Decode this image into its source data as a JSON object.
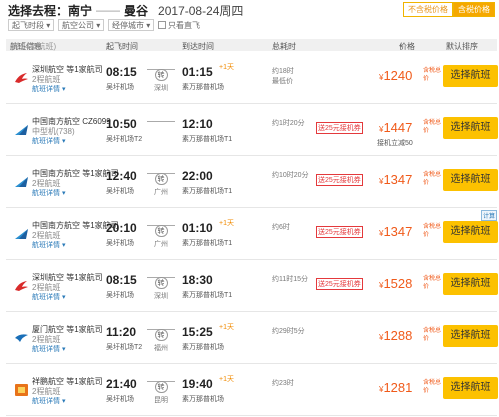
{
  "header": {
    "prefix": "选择去程：",
    "origin": "南宁",
    "dash": "——",
    "destination": "曼谷",
    "date": "2017-08-24周四"
  },
  "price_toggle": {
    "off_label": "不含税价格",
    "on_label": "含税价格"
  },
  "filters": {
    "takeoff_time": "起飞时段",
    "airline": "航空公司",
    "stopover_city": "经停城市",
    "direct_only": "只看直飞"
  },
  "columns": {
    "flight": "航班信息",
    "flight_hint": "(共24条航班)",
    "dep_time": "起飞时间",
    "arr_time": "到达时间",
    "total_time": "总耗时",
    "price": "价格",
    "sort": "默认排序"
  },
  "colors": {
    "accent": "#fcc100",
    "price": "#f05a1a",
    "link": "#2a7ab8"
  },
  "flights": [
    {
      "airline": "深圳航空 等1家航司",
      "sub": "2程航班",
      "details": "航班详情",
      "logo": "crane-logo-red",
      "dep_time": "08:15",
      "dep_airport": "吴圩机场",
      "stop_city": "深圳",
      "stop_badge": "转",
      "arr_time": "01:15",
      "plus_day": "+1天",
      "arr_airport": "素万那普机场",
      "duration": "约18时",
      "duration_note": "最低价",
      "promo": "",
      "price": "1240",
      "tax_label": "含税总价",
      "remark": "",
      "tag": "",
      "button": "选择航班"
    },
    {
      "airline": "中国南方航空 CZ6099",
      "sub": "中型机(738)",
      "details": "航班详情",
      "logo": "kapok-logo-blue",
      "dep_time": "10:50",
      "dep_airport": "吴圩机场T2",
      "stop_city": "",
      "stop_badge": "",
      "arr_time": "12:10",
      "plus_day": "",
      "arr_airport": "素万那普机场T1",
      "duration": "约1时20分",
      "duration_note": "",
      "promo": "送25元接机券",
      "price": "1447",
      "tax_label": "含税总价",
      "remark": "接机立减50",
      "tag": "",
      "button": "选择航班"
    },
    {
      "airline": "中国南方航空 等1家航司",
      "sub": "2程航班",
      "details": "航班详情",
      "logo": "kapok-logo-blue",
      "dep_time": "12:40",
      "dep_airport": "吴圩机场",
      "stop_city": "广州",
      "stop_badge": "转",
      "arr_time": "22:00",
      "plus_day": "",
      "arr_airport": "素万那普机场T1",
      "duration": "约10时20分",
      "duration_note": "",
      "promo": "送25元接机券",
      "price": "1347",
      "tax_label": "含税总价",
      "remark": "",
      "tag": "",
      "button": "选择航班"
    },
    {
      "airline": "中国南方航空 等1家航司",
      "sub": "2程航班",
      "details": "航班详情",
      "logo": "kapok-logo-blue",
      "dep_time": "20:10",
      "dep_airport": "吴圩机场",
      "stop_city": "广州",
      "stop_badge": "转",
      "arr_time": "01:10",
      "plus_day": "+1天",
      "arr_airport": "素万那普机场T1",
      "duration": "约6时",
      "duration_note": "",
      "promo": "送25元接机券",
      "price": "1347",
      "tax_label": "含税总价",
      "remark": "",
      "tag": "计算",
      "button": "选择航班"
    },
    {
      "airline": "深圳航空 等1家航司",
      "sub": "2程航班",
      "details": "航班详情",
      "logo": "crane-logo-red",
      "dep_time": "08:15",
      "dep_airport": "吴圩机场",
      "stop_city": "深圳",
      "stop_badge": "转",
      "arr_time": "18:30",
      "plus_day": "",
      "arr_airport": "素万那普机场T1",
      "duration": "约11时15分",
      "duration_note": "",
      "promo": "送25元接机券",
      "price": "1528",
      "tax_label": "含税总价",
      "remark": "",
      "tag": "",
      "button": "选择航班"
    },
    {
      "airline": "厦门航空 等1家航司",
      "sub": "2程航班",
      "details": "航班详情",
      "logo": "egret-logo-blue",
      "dep_time": "11:20",
      "dep_airport": "吴圩机场T2",
      "stop_city": "福州",
      "stop_badge": "转",
      "arr_time": "15:25",
      "plus_day": "+1天",
      "arr_airport": "素万那普机场",
      "duration": "约29时5分",
      "duration_note": "",
      "promo": "",
      "price": "1288",
      "tax_label": "含税总价",
      "remark": "",
      "tag": "",
      "button": "选择航班"
    },
    {
      "airline": "祥鹏航空 等1家航司",
      "sub": "2程航班",
      "details": "航班详情",
      "logo": "lucky-logo-orange",
      "dep_time": "21:40",
      "dep_airport": "吴圩机场",
      "stop_city": "昆明",
      "stop_badge": "转",
      "arr_time": "19:40",
      "plus_day": "+1天",
      "arr_airport": "素万那普机场",
      "duration": "约23时",
      "duration_note": "",
      "promo": "",
      "price": "1281",
      "tax_label": "含税总价",
      "remark": "",
      "tag": "",
      "button": "选择航班"
    }
  ]
}
